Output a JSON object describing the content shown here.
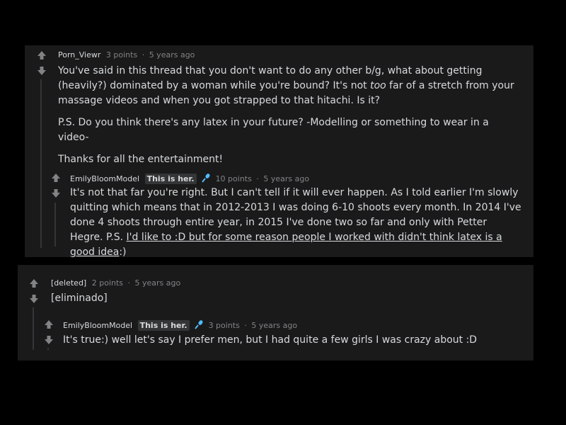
{
  "comments": [
    {
      "author": "Porn_Viewr",
      "points": "3 points",
      "sep": "·",
      "age": "5 years ago",
      "p1_a": "You've said in this thread that you don't want to do any other b/g, what about getting (heavily?) dominated by a woman while you're bound? It's not ",
      "p1_em": "too",
      "p1_b": " far of a stretch from your massage videos and when you got strapped to that hitachi. Is it?",
      "p2": "P.S. Do you think there's any latex in your future? -Modelling or something to wear in a video-",
      "p3": "Thanks for all the entertainment!",
      "reply": {
        "author": "EmilyBloomModel",
        "flair": "This is her.",
        "points": "10 points",
        "sep": "·",
        "age": "5 years ago",
        "text_a": "It's not that far you're right. But I can't tell if it will ever happen. As I told earlier I'm slowly quitting which means that in 2012-2013 I was doing 6-10 shoots every month. In 2014 I've done 4 shoots through entire year, in 2015 I've done two so far and only with Petter Hegre. P.S. ",
        "text_link": "I'd like to :D but for some reason people I worked with didn't think latex is a good idea",
        "text_b": ":)"
      }
    },
    {
      "author": "[deleted]",
      "points": "2 points",
      "sep": "·",
      "age": "5 years ago",
      "text": "[eliminado]",
      "reply": {
        "author": "EmilyBloomModel",
        "flair": "This is her.",
        "points": "3 points",
        "sep": "·",
        "age": "5 years ago",
        "text": "It's true:) well let's say I prefer men, but I had quite a few girls I was crazy about :D"
      }
    }
  ],
  "colors": {
    "card": "#1a1a1b",
    "text": "#d7dadc",
    "meta": "#818384",
    "line": "#343536"
  },
  "icons": {
    "upvote": "arrow-up-icon",
    "downvote": "arrow-down-icon",
    "mic": "microphone-icon"
  }
}
